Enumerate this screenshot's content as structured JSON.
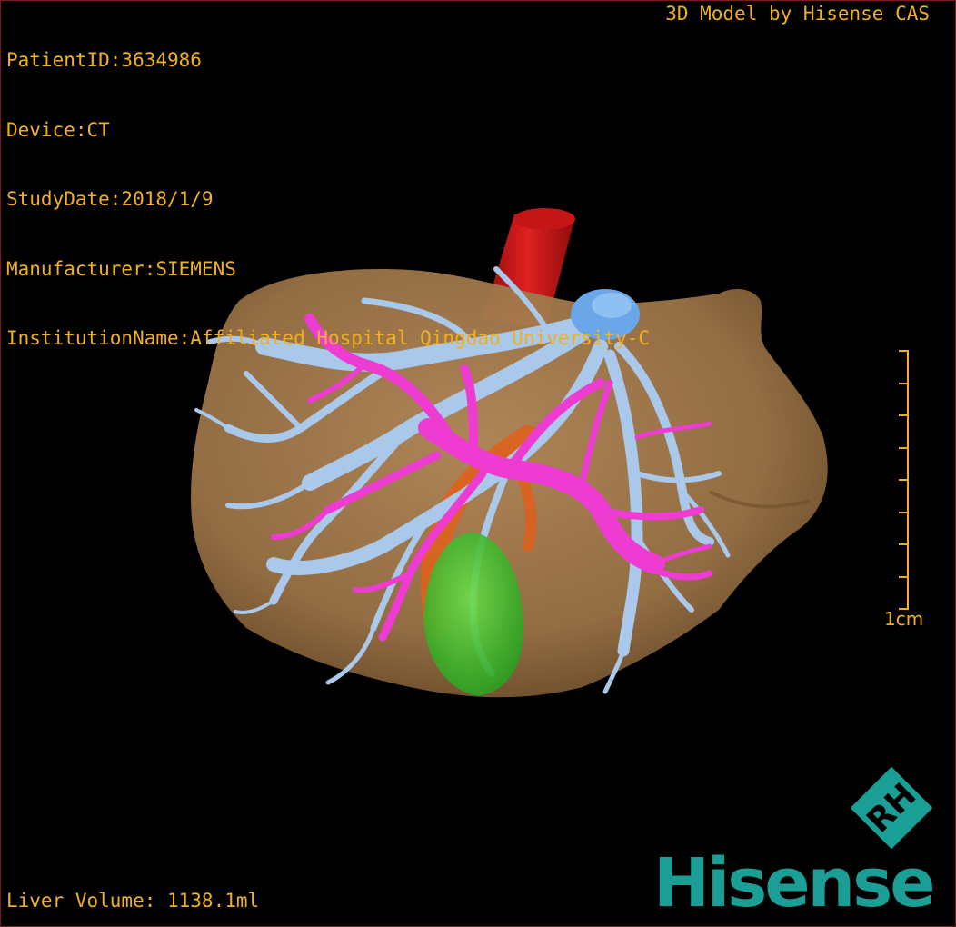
{
  "overlay": {
    "patient_id": "PatientID:3634986",
    "device": "Device:CT",
    "study_date": "StudyDate:2018/1/9",
    "manufacturer": "Manufacturer:SIEMENS",
    "institution": "InstitutionName:Affiliated Hospital Qingdao University-C",
    "model_credit": "3D Model by Hisense CAS",
    "liver_volume": "Liver Volume: 1138.1ml"
  },
  "scale_bar": {
    "label": "1cm",
    "color": "#f0b020"
  },
  "logo": {
    "wordmark": "Hisense",
    "mark_text": "RH",
    "color": "#1a9e95"
  },
  "colors": {
    "liver": "#9c7448",
    "hepatic_vein": "#a9c8ea",
    "portal_vein": "#ee3bd2",
    "ivc_artery": "#c81818",
    "gallbladder": "#33bb22",
    "bile_duct": "#e0601a",
    "vein_confluence": "#6aa6e8"
  }
}
